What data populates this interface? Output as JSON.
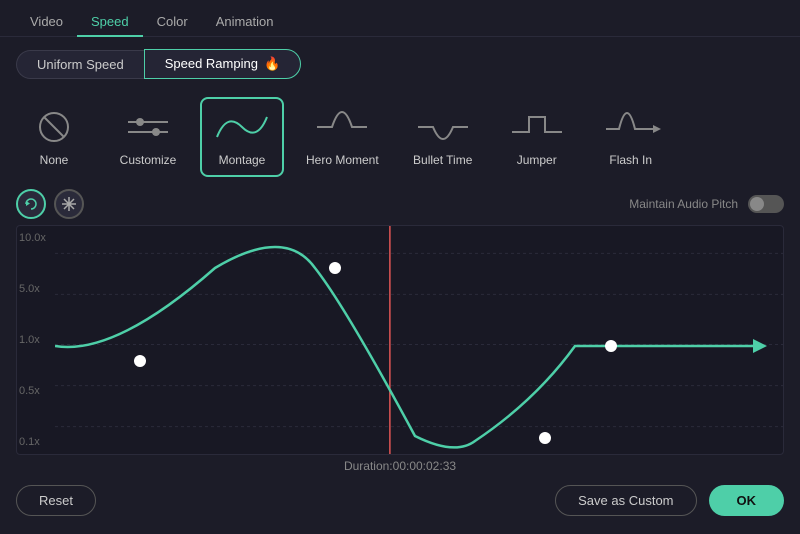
{
  "topTabs": [
    {
      "label": "Video",
      "active": false
    },
    {
      "label": "Speed",
      "active": true
    },
    {
      "label": "Color",
      "active": false
    },
    {
      "label": "Animation",
      "active": false
    }
  ],
  "speedToggles": [
    {
      "label": "Uniform Speed",
      "active": false
    },
    {
      "label": "Speed Ramping",
      "active": true,
      "fire": "🔥"
    }
  ],
  "presets": [
    {
      "label": "None",
      "icon": "none"
    },
    {
      "label": "Customize",
      "icon": "customize"
    },
    {
      "label": "Montage",
      "icon": "montage",
      "selected": true
    },
    {
      "label": "Hero Moment",
      "icon": "hero-moment"
    },
    {
      "label": "Bullet Time",
      "icon": "bullet-time"
    },
    {
      "label": "Jumper",
      "icon": "jumper"
    },
    {
      "label": "Flash In",
      "icon": "flash-in"
    }
  ],
  "chart": {
    "yLabels": [
      "10.0x",
      "5.0x",
      "1.0x",
      "0.5x",
      "0.1x"
    ],
    "duration": "Duration:00:00:02:33",
    "redLinePercent": 46
  },
  "controls": {
    "maintainAudioPitch": "Maintain Audio Pitch"
  },
  "buttons": {
    "reset": "Reset",
    "saveAsCustom": "Save as Custom",
    "ok": "OK"
  }
}
